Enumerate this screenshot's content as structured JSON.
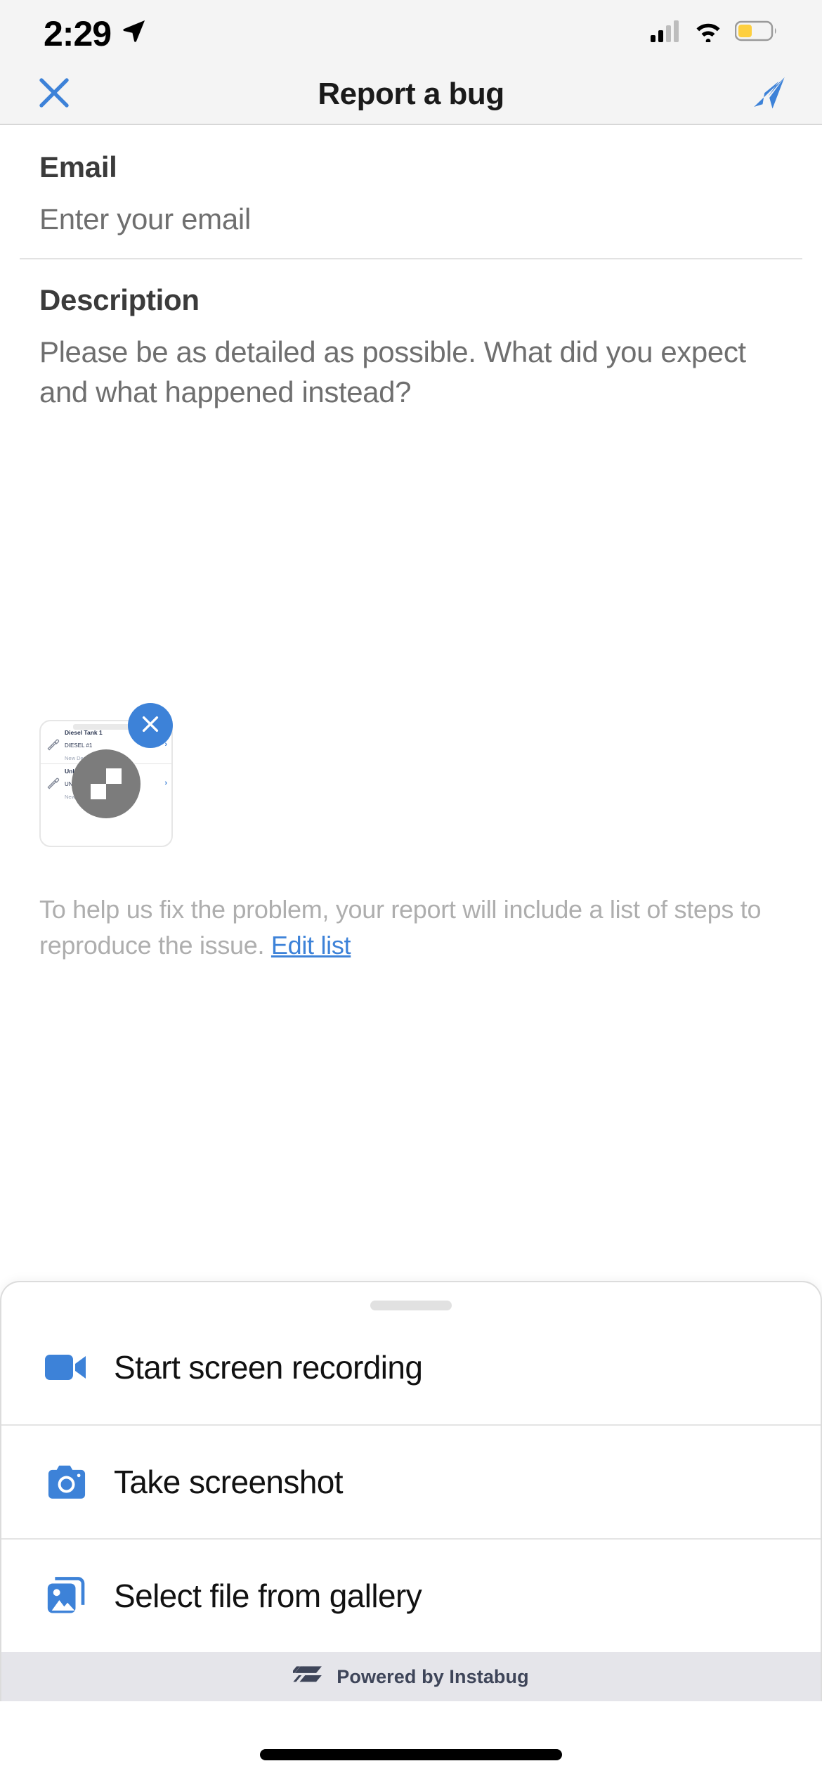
{
  "status_bar": {
    "time": "2:29",
    "location_icon": "location-arrow-icon",
    "cellular_icon": "cellular-signal-icon",
    "cellular_bars_filled": 2,
    "cellular_bars_total": 4,
    "wifi_icon": "wifi-icon",
    "battery_icon": "battery-icon",
    "battery_color": "#FDCF3F",
    "battery_level_percent": 40
  },
  "header": {
    "title": "Report a bug",
    "close_icon": "close-x-icon",
    "send_icon": "send-paper-plane-icon",
    "accent_color": "#3D82D8"
  },
  "form": {
    "email": {
      "label": "Email",
      "placeholder": "Enter your email",
      "value": ""
    },
    "description": {
      "label": "Description",
      "placeholder": "Please be as detailed as possible. What did you expect and what happened instead?",
      "value": ""
    }
  },
  "attachment": {
    "remove_icon": "close-x-icon",
    "overlay_icon": "photo-placeholder-icon",
    "preview_rows": [
      {
        "title": "Diesel Tank 1",
        "subtitle": "DIESEL #1",
        "site": "New Demo Site",
        "chevron": "›",
        "icon": "ruler-gauge-icon"
      },
      {
        "title": "Unleaded Tank 2",
        "subtitle": "UNLEADED",
        "site": "New Demo Site",
        "chevron": "›",
        "icon": "ruler-gauge-icon"
      }
    ]
  },
  "helper": {
    "text": "To help us fix the problem, your report will include a list of steps to reproduce the issue. ",
    "link_label": "Edit list"
  },
  "sheet": {
    "handle": "drag-handle",
    "items": [
      {
        "label": "Start screen recording",
        "icon": "video-camera-icon"
      },
      {
        "label": "Take screenshot",
        "icon": "camera-icon"
      },
      {
        "label": "Select file from gallery",
        "icon": "gallery-image-icon"
      }
    ]
  },
  "footer": {
    "powered_by": "Powered by Instabug",
    "logo_icon": "instabug-logo-icon",
    "background": "#E5E5EA",
    "text_color": "#3E4559"
  },
  "home_indicator": "home-indicator-bar"
}
